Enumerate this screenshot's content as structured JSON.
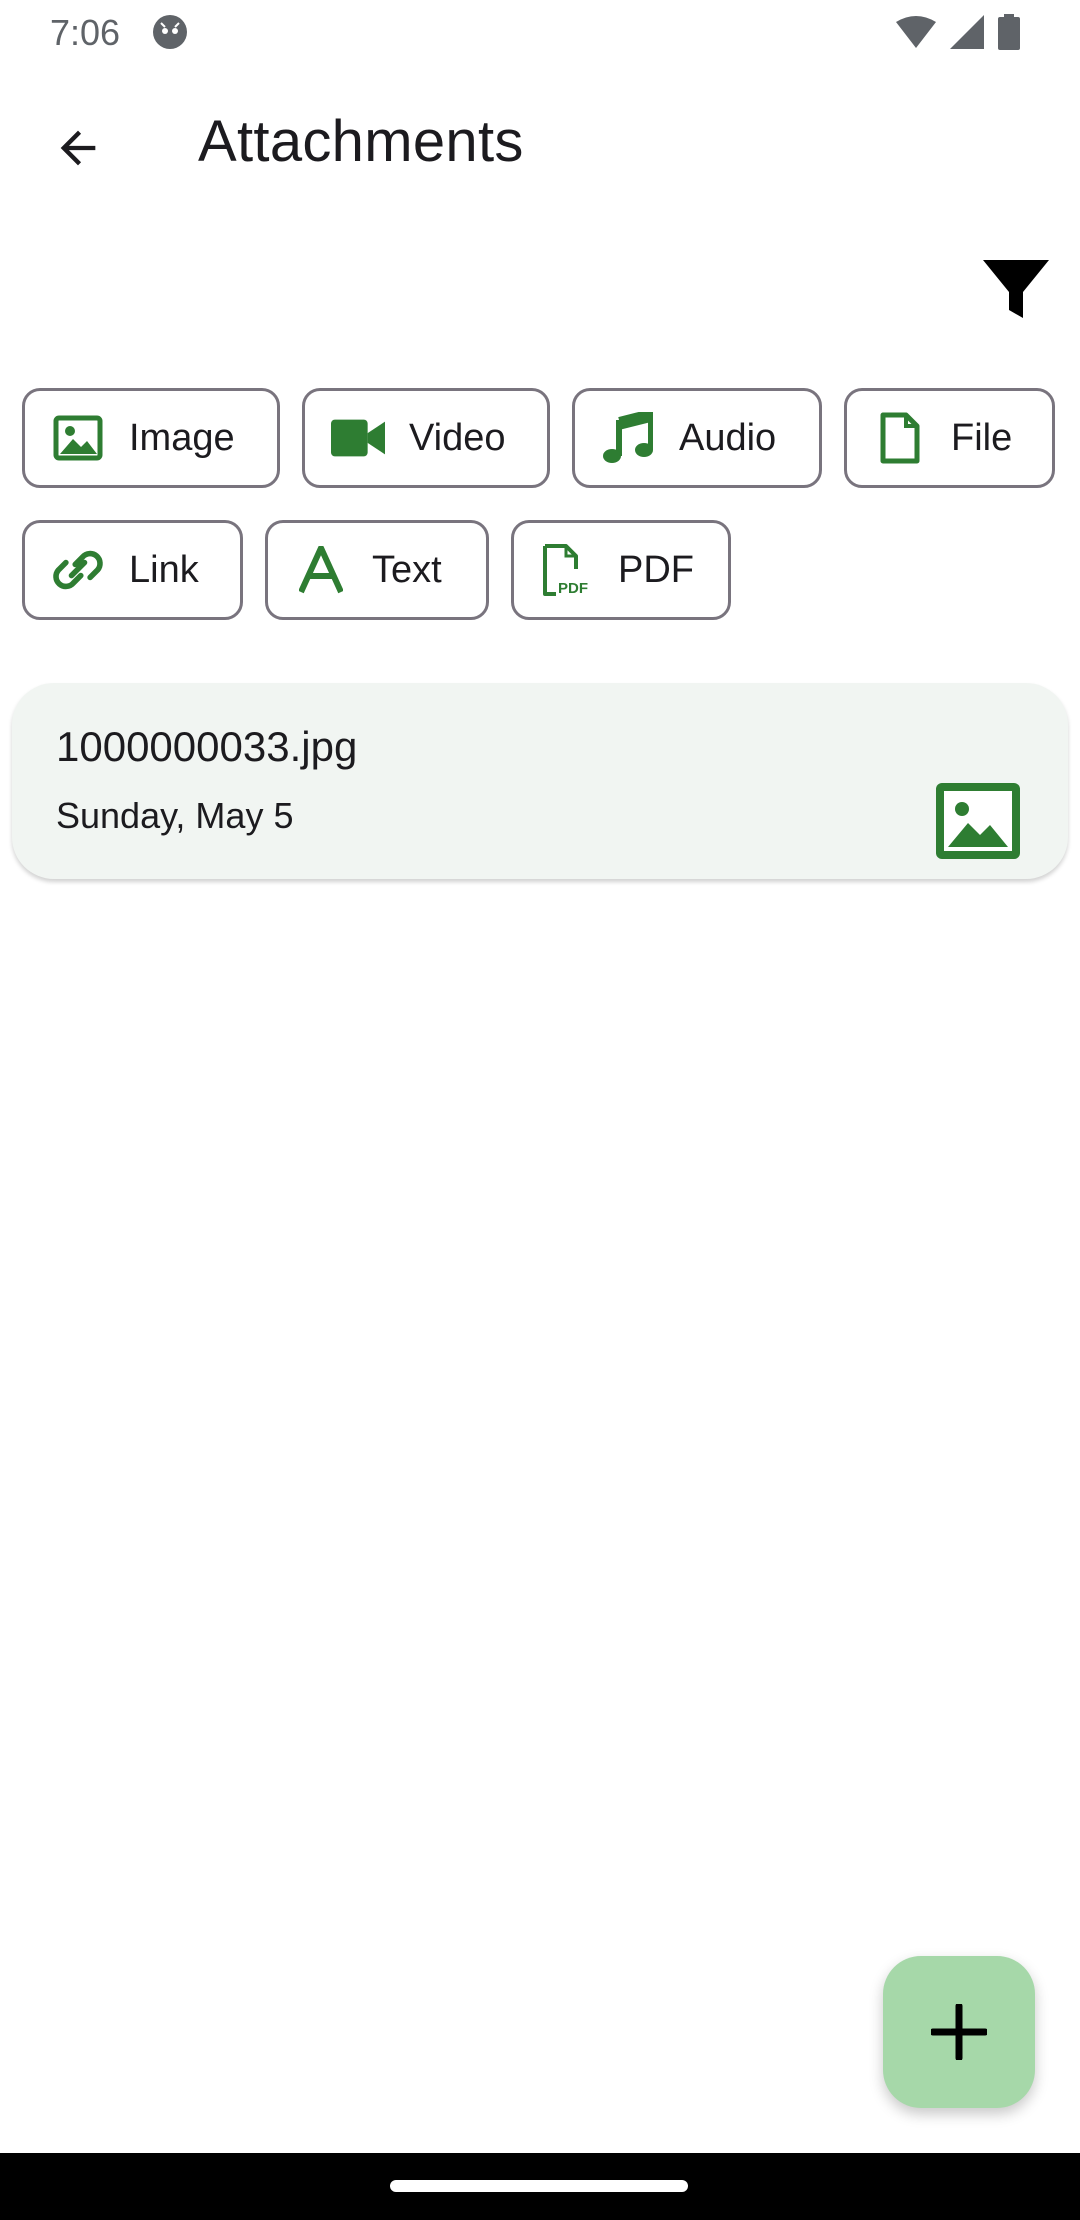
{
  "status_bar": {
    "time": "7:06",
    "icons": [
      "app-notification-icon",
      "wifi-icon",
      "signal-icon",
      "battery-icon"
    ]
  },
  "header": {
    "title": "Attachments",
    "back_icon": "arrow-back-icon",
    "filter_icon": "filter-icon"
  },
  "chips": [
    {
      "label": "Image",
      "icon": "image-icon"
    },
    {
      "label": "Video",
      "icon": "video-icon"
    },
    {
      "label": "Audio",
      "icon": "music-note-icon"
    },
    {
      "label": "File",
      "icon": "file-icon"
    },
    {
      "label": "Link",
      "icon": "link-icon"
    },
    {
      "label": "Text",
      "icon": "text-icon"
    },
    {
      "label": "PDF",
      "icon": "pdf-icon"
    }
  ],
  "attachments": [
    {
      "name": "1000000033.jpg",
      "date": "Sunday, May 5",
      "type_icon": "image-icon"
    }
  ],
  "fab": {
    "icon": "add-icon"
  },
  "colors": {
    "accent_green": "#2e7d32",
    "fab_bg": "#a6d8a9",
    "card_bg": "#f1f5f2",
    "chip_border": "#79747e"
  }
}
